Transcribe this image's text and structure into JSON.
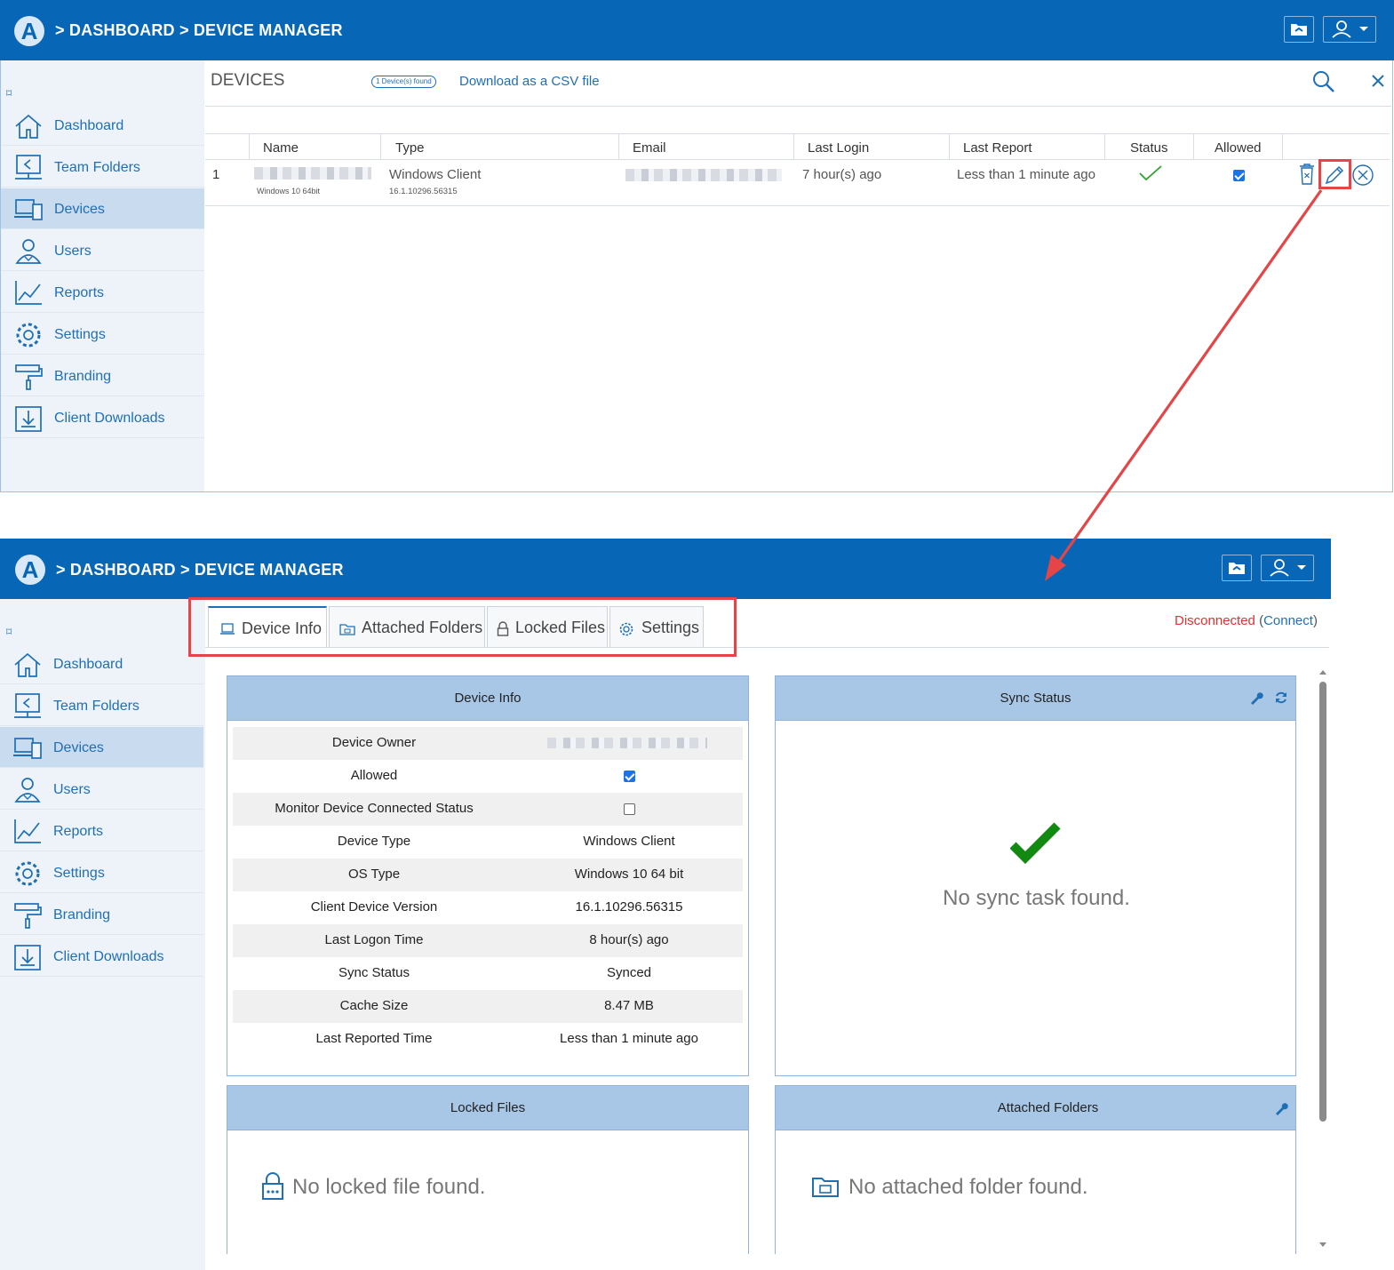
{
  "header": {
    "logo_letter": "A",
    "crumb_sep": ">",
    "crumb_dashboard": "DASHBOARD",
    "crumb_device_manager": "DEVICE MANAGER"
  },
  "sidebar": {
    "collapse_glyph": "⌑",
    "items": [
      {
        "label": "Dashboard",
        "icon": "home-icon"
      },
      {
        "label": "Team Folders",
        "icon": "team-folders-icon"
      },
      {
        "label": "Devices",
        "icon": "devices-icon"
      },
      {
        "label": "Users",
        "icon": "users-icon"
      },
      {
        "label": "Reports",
        "icon": "reports-icon"
      },
      {
        "label": "Settings",
        "icon": "gear-icon"
      },
      {
        "label": "Branding",
        "icon": "paint-roller-icon"
      },
      {
        "label": "Client Downloads",
        "icon": "download-icon"
      }
    ],
    "active": "Devices"
  },
  "devices": {
    "title": "DEVICES",
    "found_badge": "1 Device(s) found",
    "csv_link": "Download as a CSV file",
    "columns": [
      "Name",
      "Type",
      "Email",
      "Last Login",
      "Last Report",
      "Status",
      "Allowed"
    ],
    "rows": [
      {
        "index": "1",
        "name_sub": "Windows 10 64bit",
        "type": "Windows Client",
        "type_sub": "16.1.10296.56315",
        "last_login": "7 hour(s) ago",
        "last_report": "Less than 1 minute ago",
        "allowed": true
      }
    ]
  },
  "device_manager": {
    "tabs": [
      "Device Info",
      "Attached Folders",
      "Locked Files",
      "Settings"
    ],
    "connection_status": "Disconnected",
    "connect_open": "(",
    "connect_link": "Connect",
    "connect_close": ")",
    "device_info": {
      "title": "Device Info",
      "rows": [
        {
          "key": "Device Owner",
          "value": ""
        },
        {
          "key": "Allowed",
          "value": ""
        },
        {
          "key": "Monitor Device Connected Status",
          "value": ""
        },
        {
          "key": "Device Type",
          "value": "Windows Client"
        },
        {
          "key": "OS Type",
          "value": "Windows 10 64 bit"
        },
        {
          "key": "Client Device Version",
          "value": "16.1.10296.56315"
        },
        {
          "key": "Last Logon Time",
          "value": "8 hour(s) ago"
        },
        {
          "key": "Sync Status",
          "value": "Synced"
        },
        {
          "key": "Cache Size",
          "value": "8.47 MB"
        },
        {
          "key": "Last Reported Time",
          "value": "Less than 1 minute ago"
        }
      ],
      "allowed_checked": true,
      "monitor_checked": false
    },
    "sync_status": {
      "title": "Sync Status",
      "message": "No sync task found."
    },
    "locked_files": {
      "title": "Locked Files",
      "message": "No locked file found."
    },
    "attached_folders": {
      "title": "Attached Folders",
      "message": "No attached folder found."
    }
  },
  "colors": {
    "brand": "#0767b6",
    "link": "#1f6fb5",
    "disconnected": "#e0312f",
    "success": "#128a12",
    "annotation": "#e54546"
  }
}
